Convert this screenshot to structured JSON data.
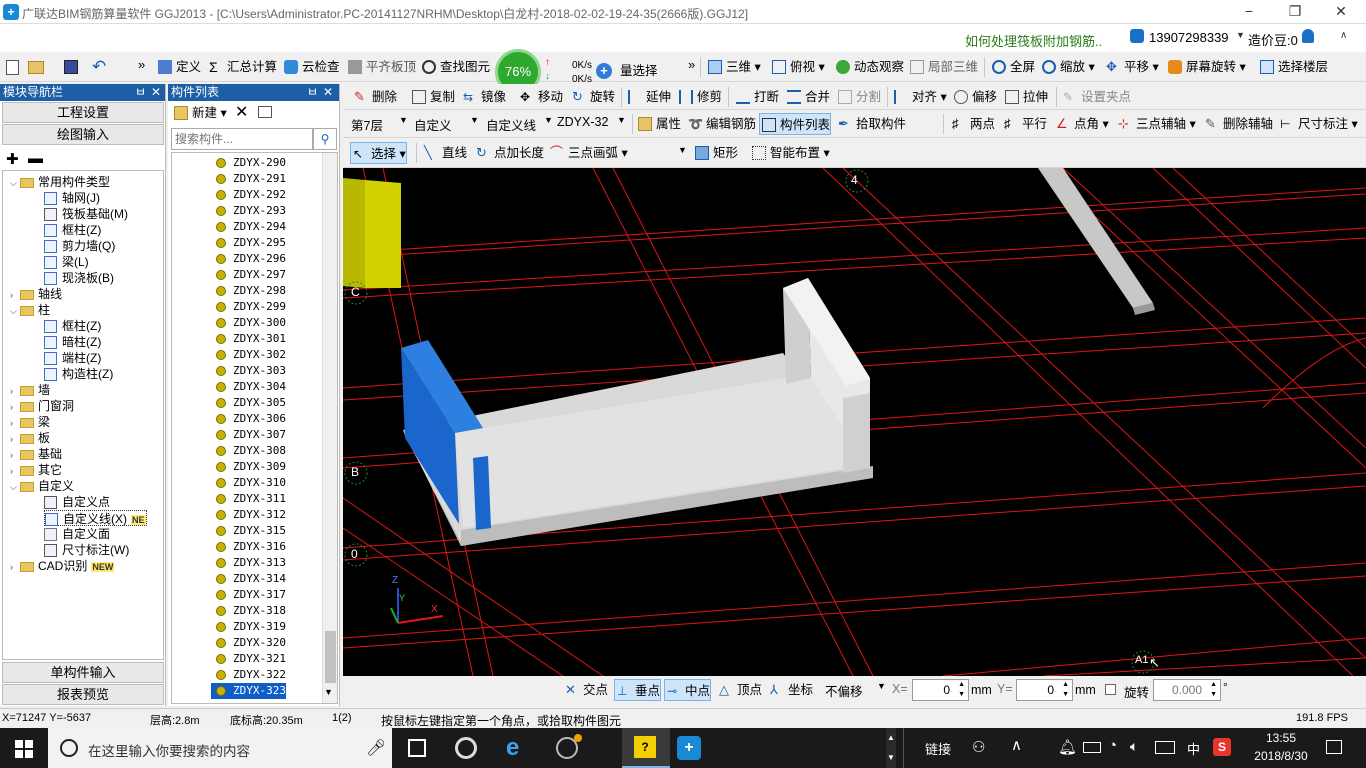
{
  "titlebar": {
    "title": "广联达BIM钢筋算量软件 GGJ2013 - [C:\\Users\\Administrator.PC-20141127NRHM\\Desktop\\白龙村-2018-02-02-19-24-35(2666版).GGJ12]",
    "icon": "app-icon",
    "minimize": "−",
    "restore": "❐",
    "close": "✕"
  },
  "infobar": {
    "help_link": "如何处理筏板附加钢筋..",
    "phone": "13907298339",
    "bean": "造价豆:0"
  },
  "toolbar1": {
    "define": "定义",
    "sum": "汇总计算",
    "cloud_check": "云检查",
    "flat_top": "平齐板顶",
    "find": "查找图元",
    "net_percent": "76%",
    "up_speed": "0K/s",
    "down_speed": "0K/s",
    "batch_select": "量选择",
    "view3d": "三维",
    "top_view": "俯视",
    "dynamic": "动态观察",
    "local3d": "局部三维",
    "fullscreen": "全屏",
    "zoom": "缩放",
    "pan": "平移",
    "screen_rotate": "屏幕旋转",
    "select_floor": "选择楼层"
  },
  "toolbar2": {
    "delete": "删除",
    "copy": "复制",
    "mirror": "镜像",
    "move": "移动",
    "rotate": "旋转",
    "extend": "延伸",
    "trim": "修剪",
    "break": "打断",
    "merge": "合并",
    "split": "分割",
    "align": "对齐",
    "offset": "偏移",
    "stretch": "拉伸",
    "set_grip": "设置夹点"
  },
  "toolbar3": {
    "floor": "第7层",
    "category": "自定义",
    "type": "自定义线",
    "component": "ZDYX-32",
    "property": "属性",
    "edit_rebar": "编辑钢筋",
    "comp_list": "构件列表",
    "pick": "拾取构件",
    "two_point": "两点",
    "parallel": "平行",
    "point_angle": "点角",
    "three_point_aux": "三点辅轴",
    "delete_aux": "删除辅轴",
    "dimension": "尺寸标注"
  },
  "toolbar4": {
    "select": "选择",
    "line": "直线",
    "point_length": "点加长度",
    "three_point_arc": "三点画弧",
    "rect": "矩形",
    "smart_layout": "智能布置"
  },
  "nav": {
    "header": "模块导航栏",
    "pin": "ㅂ",
    "close": "✕",
    "project_settings": "工程设置",
    "drawing_input": "绘图输入",
    "single_input": "单构件输入",
    "report_preview": "报表预览",
    "tree": [
      {
        "label": "常用构件类型",
        "level": 0,
        "kind": "folder",
        "expanded": true
      },
      {
        "label": "轴网(J)",
        "level": 1,
        "kind": "grid"
      },
      {
        "label": "筏板基础(M)",
        "level": 1,
        "kind": "raft"
      },
      {
        "label": "框柱(Z)",
        "level": 1,
        "kind": "col"
      },
      {
        "label": "剪力墙(Q)",
        "level": 1,
        "kind": "wall"
      },
      {
        "label": "梁(L)",
        "level": 1,
        "kind": "beam"
      },
      {
        "label": "现浇板(B)",
        "level": 1,
        "kind": "slab"
      },
      {
        "label": "轴线",
        "level": 0,
        "kind": "folder"
      },
      {
        "label": "柱",
        "level": 0,
        "kind": "folder",
        "expanded": true
      },
      {
        "label": "框柱(Z)",
        "level": 1,
        "kind": "col"
      },
      {
        "label": "暗柱(Z)",
        "level": 1,
        "kind": "col"
      },
      {
        "label": "端柱(Z)",
        "level": 1,
        "kind": "col"
      },
      {
        "label": "构造柱(Z)",
        "level": 1,
        "kind": "col2"
      },
      {
        "label": "墙",
        "level": 0,
        "kind": "folder"
      },
      {
        "label": "门窗洞",
        "level": 0,
        "kind": "folder"
      },
      {
        "label": "梁",
        "level": 0,
        "kind": "folder"
      },
      {
        "label": "板",
        "level": 0,
        "kind": "folder"
      },
      {
        "label": "基础",
        "level": 0,
        "kind": "folder"
      },
      {
        "label": "其它",
        "level": 0,
        "kind": "folder"
      },
      {
        "label": "自定义",
        "level": 0,
        "kind": "folder",
        "expanded": true
      },
      {
        "label": "自定义点",
        "level": 1,
        "kind": "pt"
      },
      {
        "label": "自定义线(X)",
        "level": 1,
        "kind": "line",
        "selected": true,
        "badge": "NE"
      },
      {
        "label": "自定义面",
        "level": 1,
        "kind": "face"
      },
      {
        "label": "尺寸标注(W)",
        "level": 1,
        "kind": "dim"
      },
      {
        "label": "CAD识别",
        "level": 0,
        "kind": "folder",
        "badge": "NEW"
      }
    ]
  },
  "complist": {
    "header": "构件列表",
    "new_btn": "新建",
    "search_placeholder": "搜索构件...",
    "items": [
      "ZDYX-290",
      "ZDYX-291",
      "ZDYX-292",
      "ZDYX-293",
      "ZDYX-294",
      "ZDYX-295",
      "ZDYX-296",
      "ZDYX-297",
      "ZDYX-298",
      "ZDYX-299",
      "ZDYX-300",
      "ZDYX-301",
      "ZDYX-302",
      "ZDYX-303",
      "ZDYX-304",
      "ZDYX-305",
      "ZDYX-306",
      "ZDYX-307",
      "ZDYX-308",
      "ZDYX-309",
      "ZDYX-310",
      "ZDYX-311",
      "ZDYX-312",
      "ZDYX-315",
      "ZDYX-316",
      "ZDYX-313",
      "ZDYX-314",
      "ZDYX-317",
      "ZDYX-318",
      "ZDYX-319",
      "ZDYX-320",
      "ZDYX-321",
      "ZDYX-322",
      "ZDYX-323"
    ],
    "selected": "ZDYX-323"
  },
  "viewport": {
    "axis_labels": [
      "4",
      "C",
      "B",
      "0",
      "A1"
    ],
    "axis_z": "Z",
    "axis_y": "Y",
    "axis_x": "X"
  },
  "snapbar": {
    "intersection": "交点",
    "perp": "垂点",
    "mid": "中点",
    "vertex": "顶点",
    "coord": "坐标",
    "offset_mode": "不偏移",
    "x_label": "X=",
    "x_val": "0",
    "mm1": "mm",
    "y_label": "Y=",
    "y_val": "0",
    "mm2": "mm",
    "rotate_label": "旋转",
    "rotate_val": "0.000",
    "degree": "°"
  },
  "statusbar": {
    "coords": "X=71247 Y=-5637",
    "floor_height": "层高:2.8m",
    "bottom_elev": "底标高:20.35m",
    "count": "1(2)",
    "hint": "按鼠标左键指定第一个角点，或拾取构件图元",
    "fps": "191.8 FPS"
  },
  "taskbar": {
    "search": "在这里输入你要搜索的内容",
    "link": "链接",
    "ime": "中",
    "time": "13:55",
    "date": "2018/8/30"
  }
}
